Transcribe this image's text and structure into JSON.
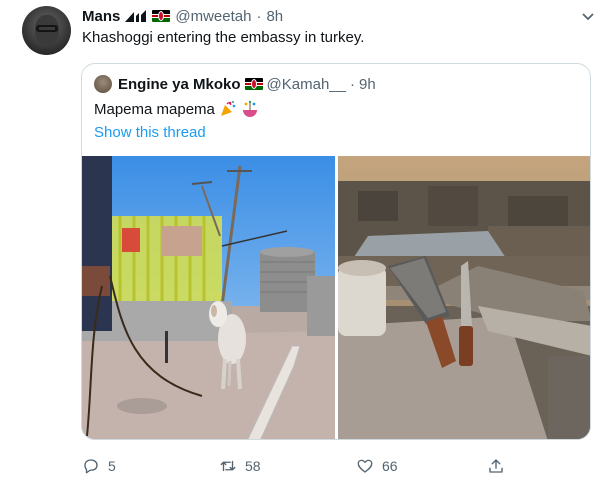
{
  "tweet": {
    "author_name": "Mans",
    "handle": "@mweetah",
    "time": "8h",
    "text": "Khashoggi entering the embassy in turkey."
  },
  "quoted_tweet": {
    "author_name": "Engine ya Mkoko",
    "handle": "@Kamah__",
    "time": "9h",
    "text": "Mapema mapema",
    "show_thread": "Show this thread",
    "photos": [
      "goat-on-rooftop-photo",
      "knives-on-rooftop-photo"
    ]
  },
  "actions": {
    "replies": "5",
    "retweets": "58",
    "likes": "66"
  },
  "colors": {
    "link": "#1d9bf0",
    "muted": "#536471",
    "border": "#cfd9de"
  }
}
